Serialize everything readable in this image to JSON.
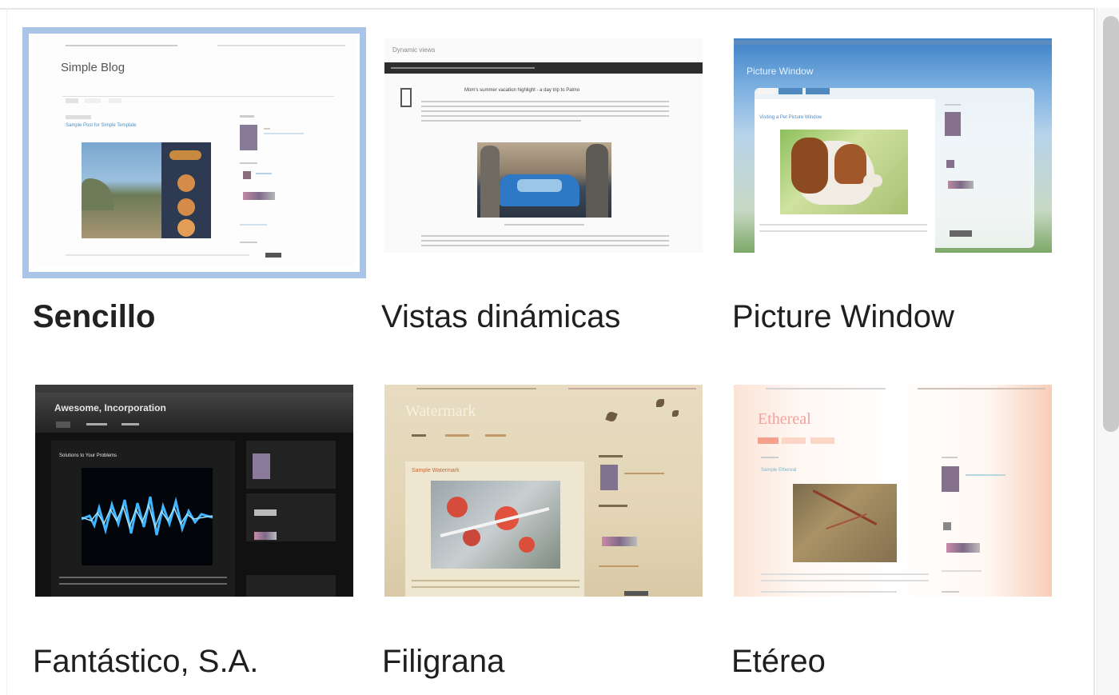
{
  "templates": [
    {
      "name": "Sencillo",
      "selected": true,
      "preview_title": "Simple Blog",
      "preview_post_title": "Sample Post for Simple Template"
    },
    {
      "name": "Vistas dinámicas",
      "selected": false,
      "preview_title": "Dynamic views",
      "preview_post_title": "Mom's summer vacation highlight - a day trip to Palmo"
    },
    {
      "name": "Picture Window",
      "selected": false,
      "preview_title": "Picture Window",
      "preview_post_title": "Visiting a Pet Picture Window"
    },
    {
      "name": "Fantástico, S.A.",
      "selected": false,
      "preview_title": "Awesome, Incorporation",
      "preview_post_title": "Solutions to Your Problems"
    },
    {
      "name": "Filigrana",
      "selected": false,
      "preview_title": "Watermark",
      "preview_post_title": "Sample Watermark"
    },
    {
      "name": "Etéreo",
      "selected": false,
      "preview_title": "Ethereal",
      "preview_post_title": "Sample Ethereal"
    }
  ],
  "colors": {
    "selection_border": "#a9c4e6",
    "label_text": "#1f1f1f",
    "scrollbar_thumb": "#c9c9c9"
  }
}
